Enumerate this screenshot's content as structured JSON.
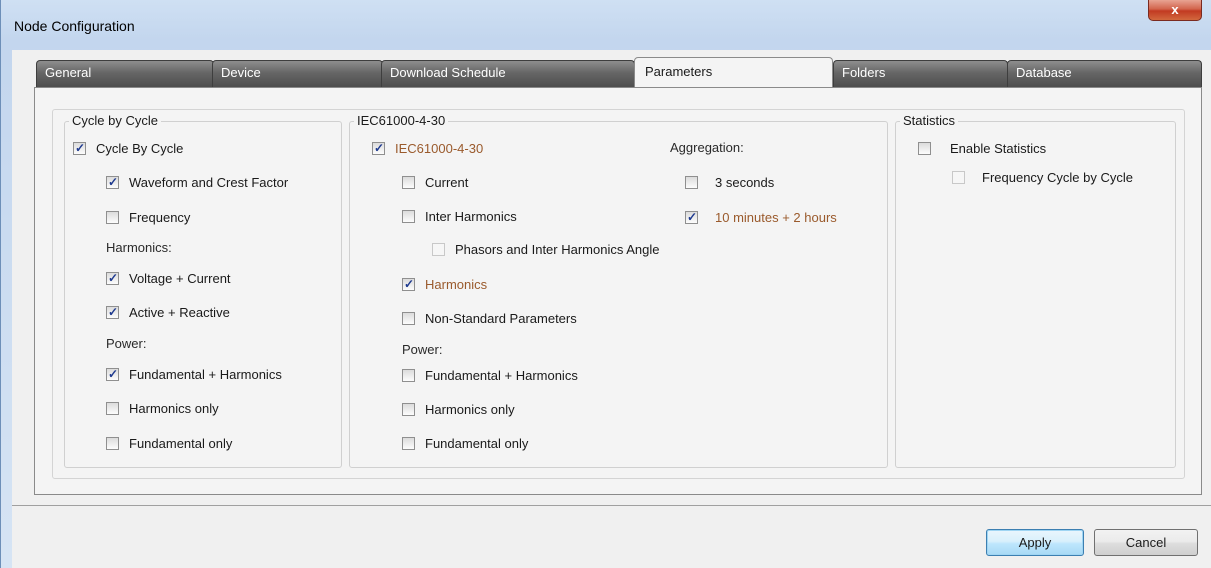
{
  "window": {
    "title": "Node Configuration",
    "close_label": "x"
  },
  "tabs": [
    {
      "label": "General"
    },
    {
      "label": "Device"
    },
    {
      "label": "Download Schedule"
    },
    {
      "label": "Parameters"
    },
    {
      "label": "Folders"
    },
    {
      "label": "Database"
    }
  ],
  "active_tab": "Parameters",
  "cycle": {
    "title": "Cycle by Cycle",
    "main": {
      "label": "Cycle By Cycle",
      "checked": true
    },
    "waveform": {
      "label": "Waveform and Crest Factor",
      "checked": true
    },
    "frequency": {
      "label": "Frequency",
      "checked": false
    },
    "harmonics_label": "Harmonics:",
    "voltage_current": {
      "label": "Voltage + Current",
      "checked": true
    },
    "active_reactive": {
      "label": "Active + Reactive",
      "checked": true
    },
    "power_label": "Power:",
    "fund_harm": {
      "label": "Fundamental + Harmonics",
      "checked": true
    },
    "harm_only": {
      "label": "Harmonics only",
      "checked": false
    },
    "fund_only": {
      "label": "Fundamental only",
      "checked": false
    }
  },
  "iec": {
    "title": "IEC61000-4-30",
    "main": {
      "label": "IEC61000-4-30",
      "checked": true
    },
    "current": {
      "label": "Current",
      "checked": false
    },
    "inter_harmonics": {
      "label": "Inter Harmonics",
      "checked": false
    },
    "phasors": {
      "label": "Phasors and Inter Harmonics Angle",
      "checked": false
    },
    "harmonics": {
      "label": "Harmonics",
      "checked": true
    },
    "non_standard": {
      "label": "Non-Standard Parameters",
      "checked": false
    },
    "power_label": "Power:",
    "fund_harm": {
      "label": "Fundamental + Harmonics",
      "checked": false
    },
    "harm_only": {
      "label": "Harmonics only",
      "checked": false
    },
    "fund_only": {
      "label": "Fundamental only",
      "checked": false
    },
    "aggregation_label": "Aggregation:",
    "agg_3s": {
      "label": "3 seconds",
      "checked": false
    },
    "agg_10m": {
      "label": "10 minutes + 2 hours",
      "checked": true
    }
  },
  "stats": {
    "title": "Statistics",
    "enable": {
      "label": "Enable Statistics",
      "checked": false
    },
    "freq_cycle": {
      "label": "Frequency Cycle by Cycle",
      "checked": false
    }
  },
  "buttons": {
    "apply": "Apply",
    "cancel": "Cancel"
  },
  "colors": {
    "accent_orange": "#9a5a2c",
    "checkmark": "#1e3a8f",
    "default_button": "#3c7fb1"
  }
}
